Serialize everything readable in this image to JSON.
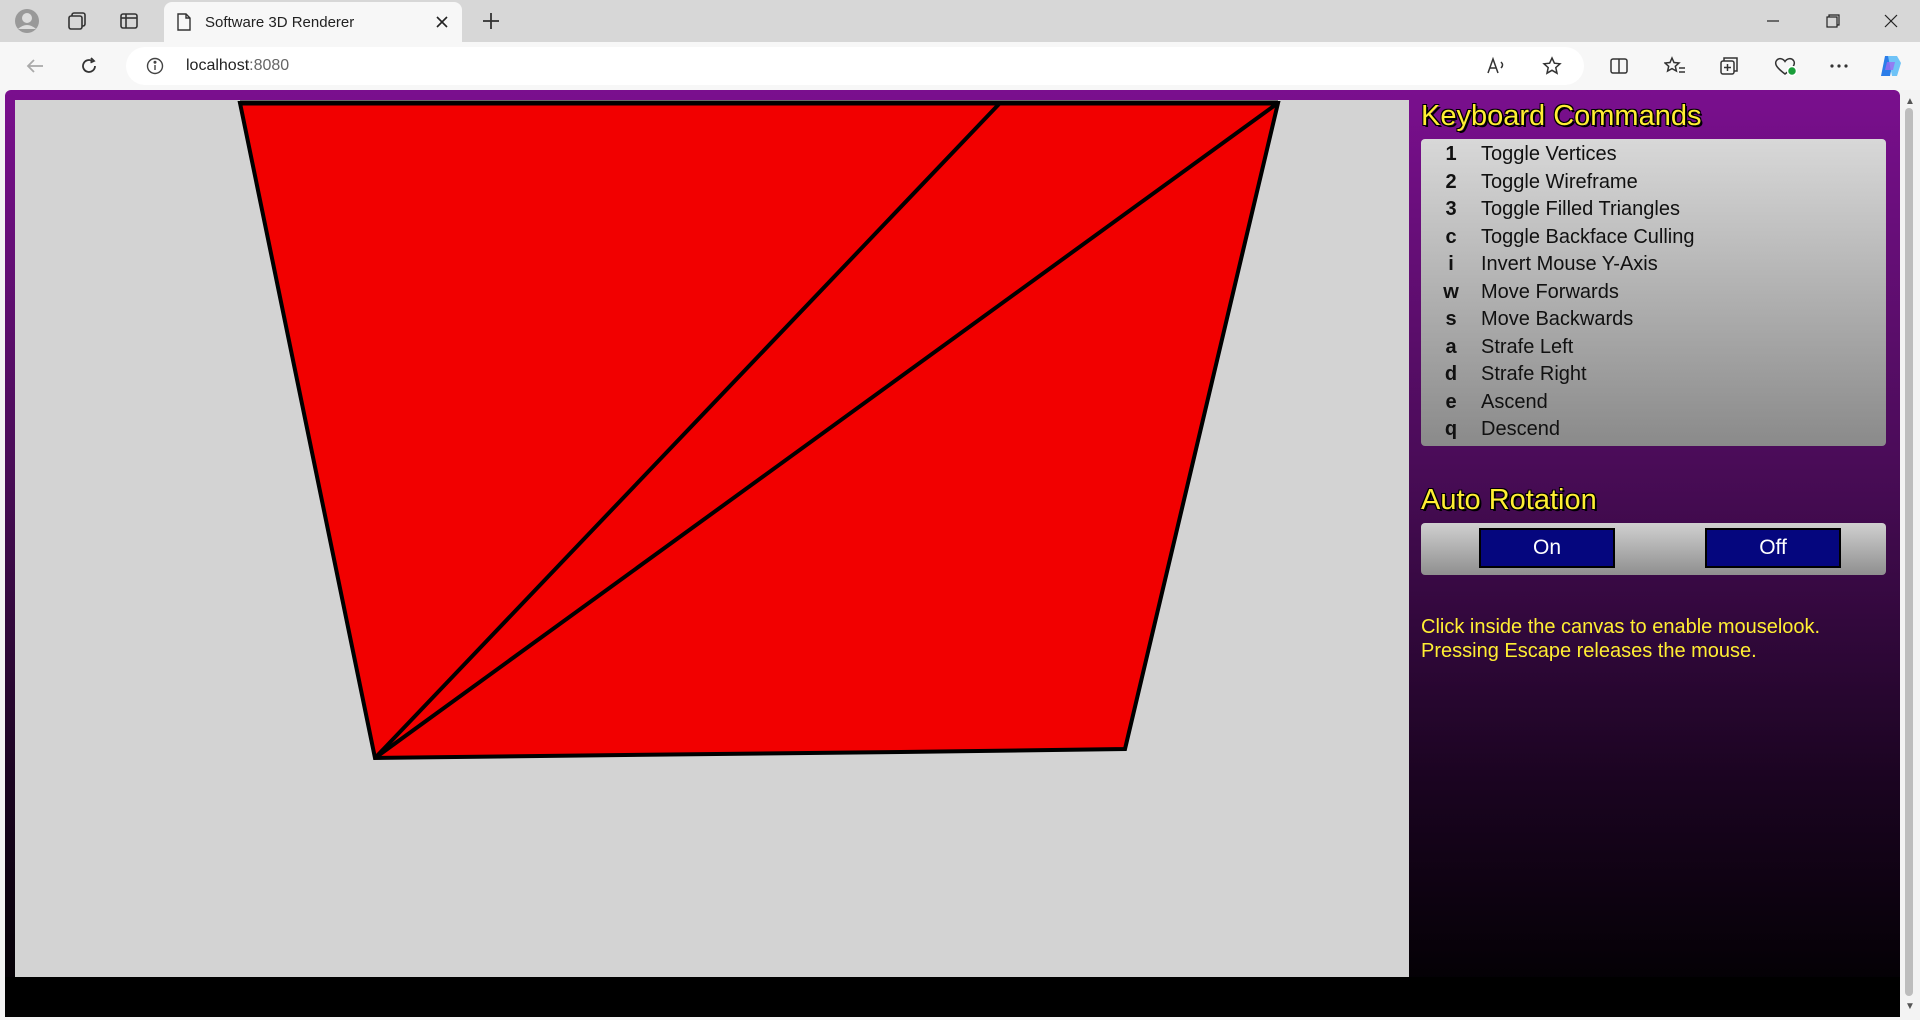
{
  "browser": {
    "tab_title": "Software 3D Renderer",
    "url_host": "localhost",
    "url_port": ":8080"
  },
  "panel": {
    "keyboard_heading": "Keyboard Commands",
    "commands": [
      {
        "key": "1",
        "label": "Toggle Vertices"
      },
      {
        "key": "2",
        "label": "Toggle Wireframe"
      },
      {
        "key": "3",
        "label": "Toggle Filled Triangles"
      },
      {
        "key": "c",
        "label": "Toggle Backface Culling"
      },
      {
        "key": "i",
        "label": "Invert Mouse Y-Axis"
      },
      {
        "key": "w",
        "label": "Move Forwards"
      },
      {
        "key": "s",
        "label": "Move Backwards"
      },
      {
        "key": "a",
        "label": "Strafe Left"
      },
      {
        "key": "d",
        "label": "Strafe Right"
      },
      {
        "key": "e",
        "label": "Ascend"
      },
      {
        "key": "q",
        "label": "Descend"
      }
    ],
    "auto_rotation_heading": "Auto Rotation",
    "on_label": "On",
    "off_label": "Off",
    "info_line1": "Click inside the canvas to enable mouselook.",
    "info_line2": "Pressing Escape releases the mouse."
  },
  "colors": {
    "canvas_bg": "#d3d3d3",
    "triangle_fill": "#f20000",
    "accent_yellow": "#ffee33",
    "button_blue": "#05067e"
  }
}
